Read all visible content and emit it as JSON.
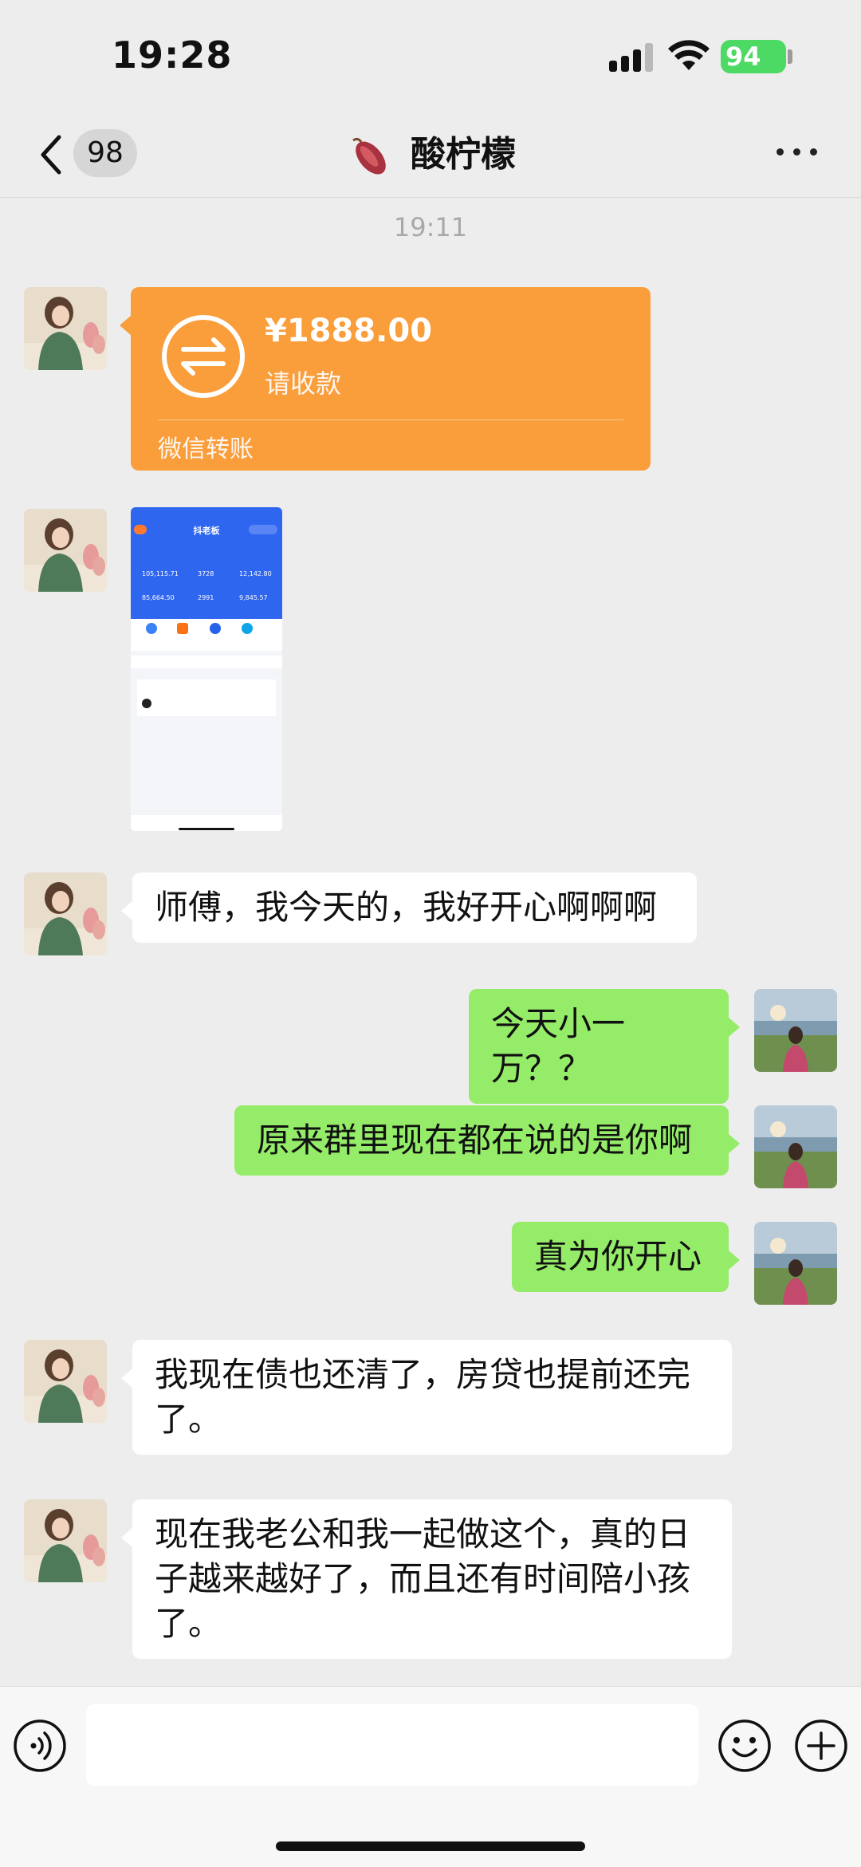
{
  "status_bar": {
    "time": "19:28",
    "battery": "94"
  },
  "nav": {
    "unread_count": "98",
    "title": "酸柠檬"
  },
  "timestamp": "19:11",
  "transfer": {
    "amount": "¥1888.00",
    "status": "请收款",
    "footer": "微信转账"
  },
  "screenshot_thumb": {
    "app_title": "抖老板",
    "stats": [
      "105,115.71",
      "3728",
      "12,142.80",
      "85,664.50",
      "2991",
      "9,845.57"
    ]
  },
  "messages": [
    {
      "side": "in",
      "text": "师傅，我今天的，我好开心啊啊啊"
    },
    {
      "side": "out",
      "text": "今天小一万？？"
    },
    {
      "side": "out",
      "text": "原来群里现在都在说的是你啊"
    },
    {
      "side": "out",
      "text": "真为你开心"
    },
    {
      "side": "in",
      "text": "我现在债也还清了，房贷也提前还完了。"
    },
    {
      "side": "in",
      "text": "现在我老公和我一起做这个，真的日子越来越好了，而且还有时间陪小孩了。"
    }
  ],
  "icons": {
    "back": "chevron-left-icon",
    "title": "sweet-potato-icon",
    "more": "more-dots-icon",
    "voice": "voice-icon",
    "emoji": "emoji-icon",
    "plus": "plus-icon",
    "transfer": "transfer-arrows-icon"
  },
  "colors": {
    "transfer": "#fa9d3b",
    "outgoing_bubble": "#95ec69",
    "background": "#ededed"
  }
}
